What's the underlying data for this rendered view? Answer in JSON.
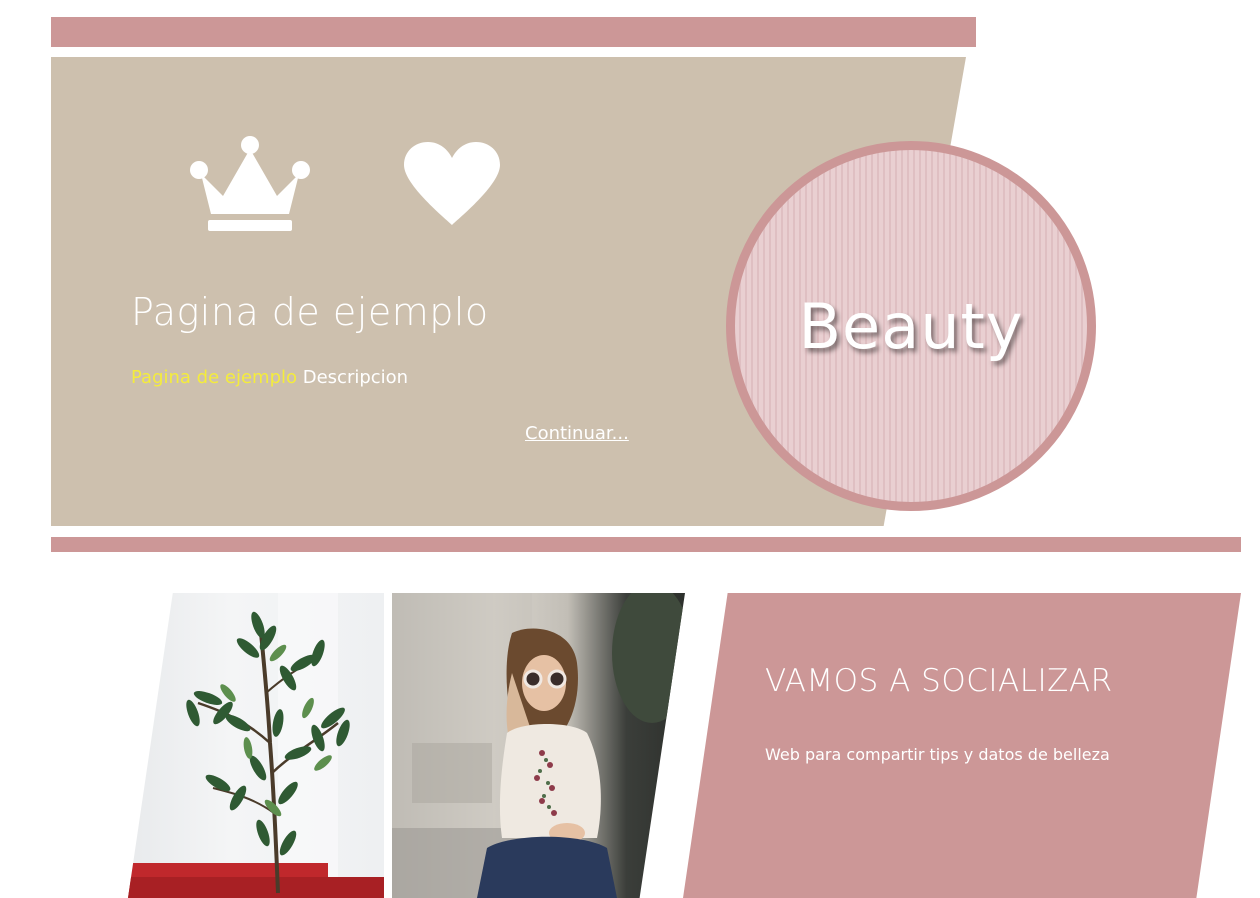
{
  "hero": {
    "title": "Pagina de ejemplo",
    "description_accent": "Pagina de ejemplo",
    "description_rest": " Descripcion",
    "continue_label": "Continuar...",
    "icons": [
      "crown-icon",
      "heart-icon"
    ]
  },
  "badge": {
    "text": "Beauty"
  },
  "social": {
    "title": "VAMOS A SOCIALIZAR",
    "description": "Web para compartir tips y datos de belleza"
  },
  "colors": {
    "accent_rose": "#cc9797",
    "hero_beige": "#cdc0ae",
    "highlight_yellow": "#f4ec3c",
    "text_white": "#ffffff"
  }
}
